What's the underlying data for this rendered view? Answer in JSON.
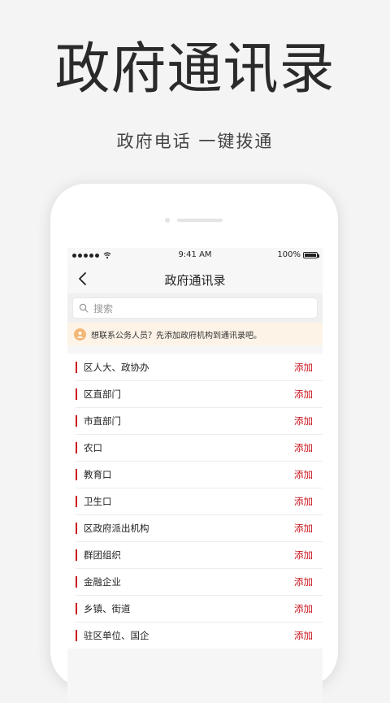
{
  "hero": {
    "title": "政府通讯录",
    "subtitle": "政府电话 一键拨通"
  },
  "status_bar": {
    "time": "9:41 AM",
    "battery": "100%"
  },
  "nav": {
    "title": "政府通讯录",
    "back_icon": "chevron-left-icon"
  },
  "search": {
    "placeholder": "搜索",
    "value": "",
    "icon": "search-icon"
  },
  "notice": {
    "text": "想联系公务人员？先添加政府机构到通讯录吧。",
    "icon": "person-icon"
  },
  "list": {
    "add_label": "添加",
    "items": [
      {
        "label": "区人大、政协办"
      },
      {
        "label": "区直部门"
      },
      {
        "label": "市直部门"
      },
      {
        "label": "农口"
      },
      {
        "label": "教育口"
      },
      {
        "label": "卫生口"
      },
      {
        "label": "区政府派出机构"
      },
      {
        "label": "群团组织"
      },
      {
        "label": "金融企业"
      },
      {
        "label": "乡镇、街道"
      },
      {
        "label": "驻区单位、国企"
      }
    ]
  },
  "colors": {
    "accent": "#c8161e",
    "notice_bg": "#fdf3e7",
    "notice_icon": "#f3b775"
  }
}
